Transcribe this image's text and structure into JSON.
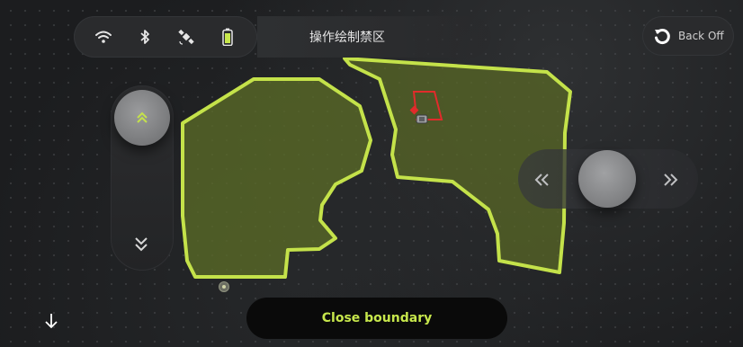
{
  "status_bar": {
    "icons": [
      "wifi-icon",
      "bluetooth-icon",
      "satellite-icon",
      "battery-icon"
    ]
  },
  "title": {
    "text": "操作绘制禁区"
  },
  "back_off": {
    "label": "Back Off",
    "icon": "undo-icon"
  },
  "joystick_vertical": {
    "up_icon": "double-chevron-up-icon",
    "down_icon": "double-chevron-down-icon"
  },
  "joystick_horizontal": {
    "left_icon": "double-chevron-left-icon",
    "right_icon": "double-chevron-right-icon"
  },
  "close_boundary": {
    "label": "Close boundary"
  },
  "colors": {
    "boundary": "#c4e24a",
    "zone_fill": "#5a6a26",
    "no_go_line": "#e12b2b",
    "button_text": "#c7e74c"
  }
}
